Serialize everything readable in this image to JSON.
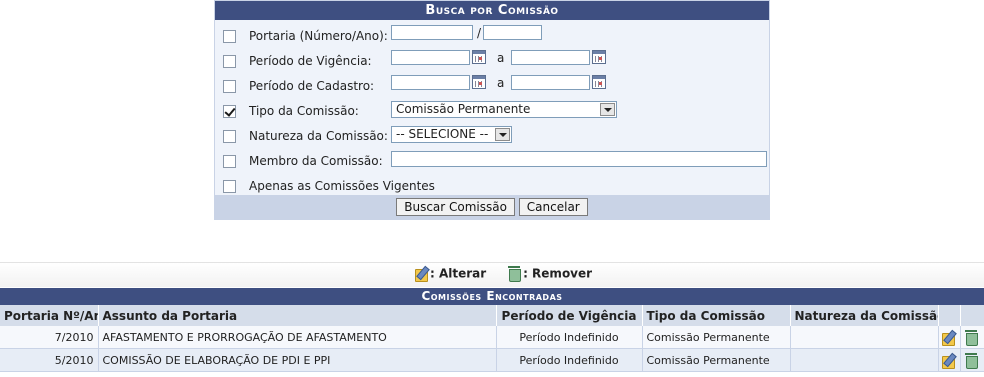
{
  "form": {
    "title": "Busca por Comissão",
    "fields": {
      "portaria_label": "Portaria (Número/Ano):",
      "portaria_sep": "/",
      "vigencia_label": "Período de Vigência:",
      "vigencia_sep": "a",
      "cadastro_label": "Período de Cadastro:",
      "cadastro_sep": "a",
      "tipo_label": "Tipo da Comissão:",
      "tipo_value": "Comissão Permanente",
      "natureza_label": "Natureza da Comissão:",
      "natureza_value": "-- SELECIONE --",
      "membro_label": "Membro da Comissão:",
      "vigentes_label": "Apenas as Comissões Vigentes"
    },
    "buttons": {
      "search": "Buscar Comissão",
      "cancel": "Cancelar"
    }
  },
  "legend": {
    "edit_label": ": Alterar",
    "remove_label": ": Remover"
  },
  "results": {
    "title": "Comissões Encontradas",
    "columns": [
      "Portaria Nº/Ano",
      "Assunto da Portaria",
      "Período de Vigência",
      "Tipo da Comissão",
      "Natureza da Comissão"
    ],
    "rows": [
      {
        "portaria": "7/2010",
        "assunto": "AFASTAMENTO E PRORROGAÇÃO DE AFASTAMENTO",
        "periodo": "Período Indefinido",
        "tipo": "Comissão Permanente",
        "natureza": ""
      },
      {
        "portaria": "5/2010",
        "assunto": "COMISSÃO DE ELABORAÇÃO DE PDI E PPI",
        "periodo": "Período Indefinido",
        "tipo": "Comissão Permanente",
        "natureza": ""
      }
    ]
  },
  "icons": {
    "edit": "edit-pencil-icon",
    "remove": "trash-bin-icon"
  },
  "colors": {
    "header_bg": "#3e4f81",
    "form_bg": "#eff3fa",
    "footer_bg": "#c9d3e6",
    "column_header_bg": "#d5ddea"
  }
}
